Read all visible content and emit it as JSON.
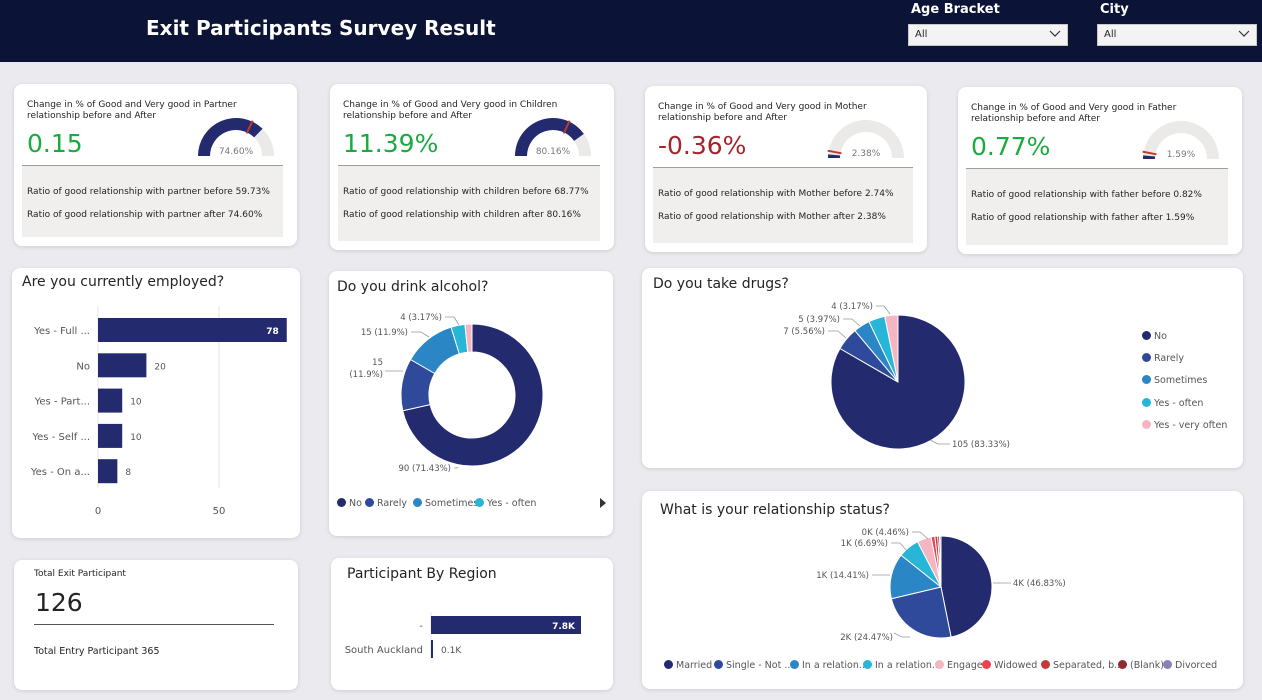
{
  "header": {
    "title": "Exit Participants Survey Result"
  },
  "slicers": [
    {
      "label": "Age Bracket",
      "value": "All"
    },
    {
      "label": "City",
      "value": "All"
    }
  ],
  "kpis": [
    {
      "caption": "Change in % of Good and Very good in Partner relationship before and After",
      "value": "0.15",
      "gauge_label": "74.60%",
      "gauge_fraction": 0.746,
      "line1": "Ratio of good relationship with partner before  59.73%",
      "line2": "Ratio of good relationship with partner after  74.60%",
      "color": "#1aab40"
    },
    {
      "caption": "Change in % of Good and Very good in Children relationship before and After",
      "value": "11.39%",
      "gauge_label": "80.16%",
      "gauge_fraction": 0.8016,
      "line1": "Ratio of good relationship with children before  68.77%",
      "line2": "Ratio of good relationship with children after  80.16%",
      "color": "#1aab40"
    },
    {
      "caption": "Change in % of Good and Very good in Mother relationship before and After",
      "value": "-0.36%",
      "gauge_label": "2.38%",
      "gauge_fraction": 0.0238,
      "line1": "Ratio of good relationship with Mother before  2.74%",
      "line2": "Ratio of good relationship with Mother after  2.38%",
      "color": "#a4262c"
    },
    {
      "caption": "Change in % of Good and Very good in Father relationship before and After",
      "value": "0.77%",
      "gauge_label": "1.59%",
      "gauge_fraction": 0.0159,
      "line1": "Ratio of good relationship with father before  0.82%",
      "line2": "Ratio of good relationship with father after  1.59%",
      "color": "#1aab40"
    }
  ],
  "employment": {
    "title": "Are you currently employed?",
    "axis_ticks": [
      "0",
      "50"
    ]
  },
  "alcohol": {
    "title": "Do you drink alcohol?"
  },
  "drugs": {
    "title": "Do you take drugs?"
  },
  "relationship": {
    "title": "What is your relationship status?"
  },
  "totals": {
    "exit_label": "Total Exit Participant",
    "exit_value": "126",
    "entry_label": "Total Entry Participant",
    "entry_value": "365"
  },
  "region": {
    "title": "Participant By Region"
  },
  "colors": {
    "navy": "#232a6e",
    "blue": "#2f4a9a",
    "mid": "#2b86c5",
    "cyan": "#27b5d8",
    "pink": "#f4b6c2",
    "green": "#1aab40",
    "red": "#a4262c"
  },
  "chart_data": [
    {
      "type": "bar",
      "name": "employment",
      "categories": [
        "Yes - Full ...",
        "No",
        "Yes - Part...",
        "Yes - Self ...",
        "Yes - On a..."
      ],
      "values": [
        78,
        20,
        10,
        10,
        8
      ],
      "xlim": [
        0,
        100
      ]
    },
    {
      "type": "pie",
      "name": "alcohol",
      "donut": true,
      "categories": [
        "No",
        "Rarely",
        "Sometimes",
        "Yes - often",
        "Yes - very often"
      ],
      "values": [
        90,
        15,
        15,
        4,
        2
      ],
      "labels": [
        "90 (71.43%)",
        "15 (11.9%)",
        "15 (11.9%)",
        "4 (3.17%)",
        ""
      ],
      "legend": [
        "No",
        "Rarely",
        "Sometimes",
        "Yes - often"
      ]
    },
    {
      "type": "pie",
      "name": "drugs",
      "categories": [
        "No",
        "Rarely",
        "Sometimes",
        "Yes - often",
        "Yes - very often"
      ],
      "values": [
        105,
        7,
        5,
        5,
        4
      ],
      "labels": [
        "105 (83.33%)",
        "7 (5.56%)",
        "5 (3.97%)",
        "",
        "4 (3.17%)"
      ],
      "legend": [
        "No",
        "Rarely",
        "Sometimes",
        "Yes - often",
        "Yes - very often"
      ]
    },
    {
      "type": "pie",
      "name": "relationship",
      "categories": [
        "Married",
        "Single - Not ...",
        "In a relation...",
        "In a relation...",
        "Engaged",
        "Widowed",
        "Separated, b...",
        "(Blank)",
        "Divorced"
      ],
      "values": [
        46.83,
        24.47,
        14.41,
        6.69,
        4.46,
        1.2,
        0.9,
        0.6,
        0.44
      ],
      "labels": [
        "4K (46.83%)",
        "2K (24.47%)",
        "1K (14.41%)",
        "1K (6.69%)",
        "0K (4.46%)",
        "",
        "",
        "",
        ""
      ]
    },
    {
      "type": "bar",
      "name": "region",
      "categories": [
        "-",
        "South Auckland"
      ],
      "values": [
        7.8,
        0.1
      ],
      "value_labels": [
        "7.8K",
        "0.1K"
      ]
    }
  ]
}
